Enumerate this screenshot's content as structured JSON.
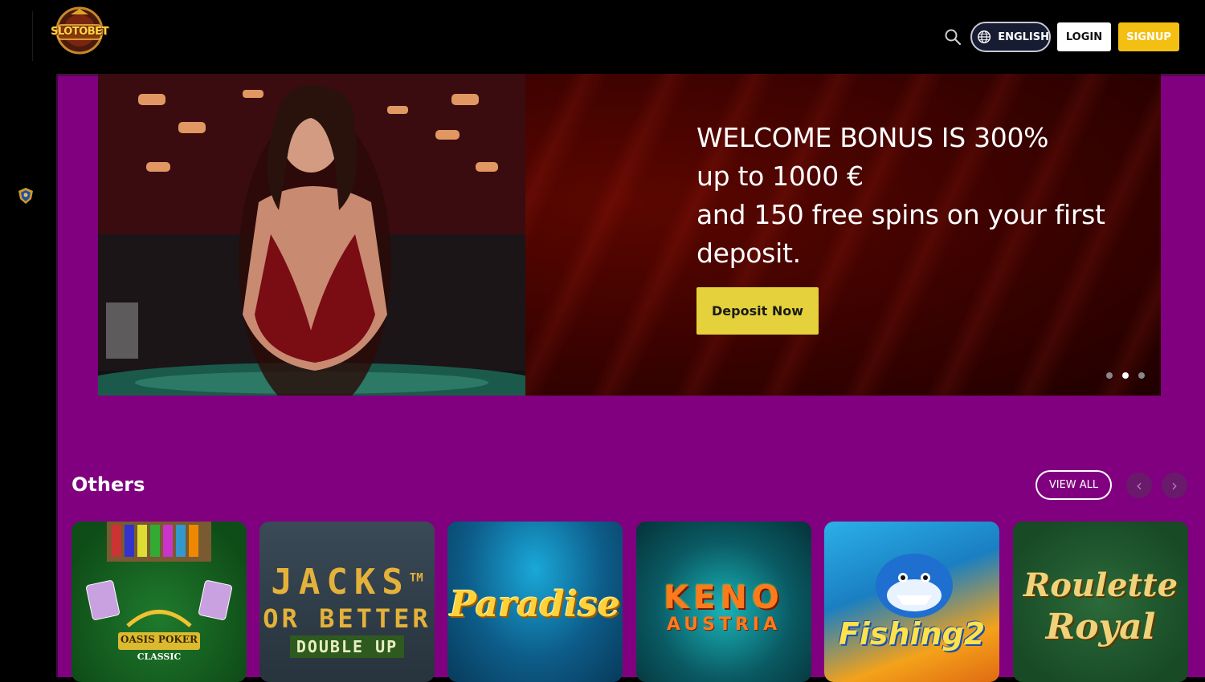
{
  "header": {
    "logo_text": "SLOTOBET",
    "language_label": "ENGLISH",
    "login_label": "LOGIN",
    "signup_label": "SIGNUP"
  },
  "banner": {
    "lines": [
      "WELCOME BONUS IS 300%",
      "up to 1000 €",
      "and 150 free spins on your first",
      "deposit."
    ],
    "cta_label": "Deposit Now",
    "slides_total": 3,
    "active_slide": 2
  },
  "section": {
    "title": "Others",
    "view_all_label": "VIEW ALL",
    "prev_icon": "chevron-left-icon",
    "next_icon": "chevron-right-icon"
  },
  "games": [
    {
      "title": "OASIS POKER",
      "subtitle": "CLASSIC"
    },
    {
      "title": "JACKS",
      "title_mark": "TM",
      "line2": "OR BETTER",
      "line3": "DOUBLE UP"
    },
    {
      "title": "Paradise"
    },
    {
      "title": "KENO",
      "line2": "AUSTRIA"
    },
    {
      "title": "Fishing2"
    },
    {
      "title": "Roulette",
      "line2": "Royal"
    }
  ],
  "colors": {
    "main_bg": "#800080",
    "signup": "#f4bf13",
    "deposit_btn": "#e4d13b"
  }
}
